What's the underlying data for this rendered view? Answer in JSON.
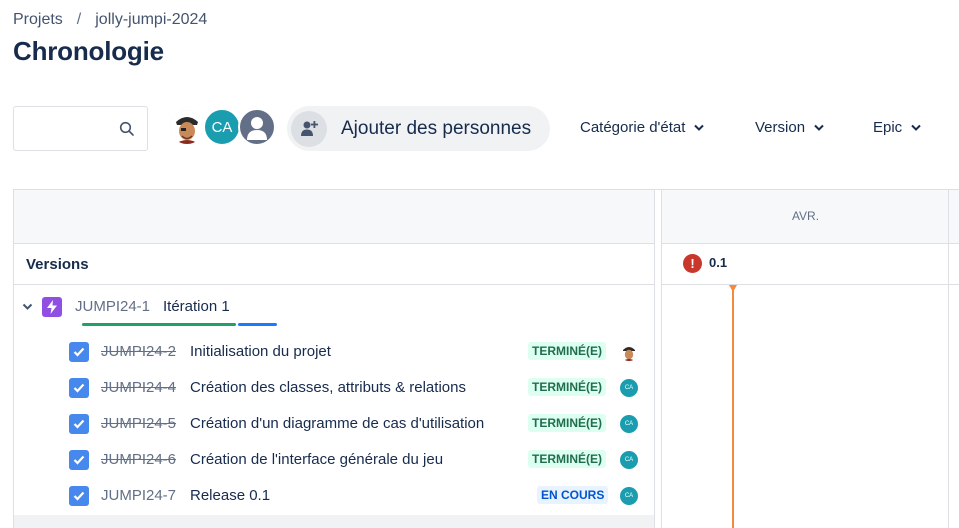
{
  "breadcrumb": {
    "projects": "Projets",
    "separator": "/",
    "project": "jolly-jumpi-2024"
  },
  "page": {
    "title": "Chronologie"
  },
  "search": {
    "placeholder": ""
  },
  "avatars": {
    "ca_initials": "CA"
  },
  "add_people": {
    "label": "Ajouter des personnes"
  },
  "filters": [
    {
      "label": "Catégorie d'état"
    },
    {
      "label": "Version"
    },
    {
      "label": "Epic"
    }
  ],
  "timeline": {
    "month": "AVR.",
    "versions_label": "Versions",
    "version_marker": {
      "label": "0.1",
      "icon": "warning-icon",
      "color": "#c9372c"
    },
    "today_color": "#f38a3f"
  },
  "epic": {
    "key": "JUMPI24-1",
    "summary": "Itération 1",
    "progress_done_fraction": 0.8,
    "progress_inprogress_fraction": 0.2
  },
  "issues": [
    {
      "key": "JUMPI24-2",
      "summary": "Initialisation du projet",
      "status": "TERMINÉ(E)",
      "done": true,
      "assignee": "face"
    },
    {
      "key": "JUMPI24-4",
      "summary": "Création des classes, attributs & relations",
      "status": "TERMINÉ(E)",
      "done": true,
      "assignee": "CA"
    },
    {
      "key": "JUMPI24-5",
      "summary": "Création d'un diagramme de cas d'utilisation",
      "status": "TERMINÉ(E)",
      "done": true,
      "assignee": "CA"
    },
    {
      "key": "JUMPI24-6",
      "summary": "Création de l'interface générale du jeu",
      "status": "TERMINÉ(E)",
      "done": true,
      "assignee": "CA"
    },
    {
      "key": "JUMPI24-7",
      "summary": "Release 0.1",
      "status": "EN COURS",
      "done": false,
      "assignee": "CA"
    }
  ],
  "colors": {
    "done_lozenge_bg": "#dcfff1",
    "done_lozenge_text": "#216e4e",
    "inprogress_lozenge_bg": "#e9f2ff",
    "inprogress_lozenge_text": "#0055cc",
    "epic_icon": "#904ee2",
    "checkbox": "#4688ec"
  }
}
